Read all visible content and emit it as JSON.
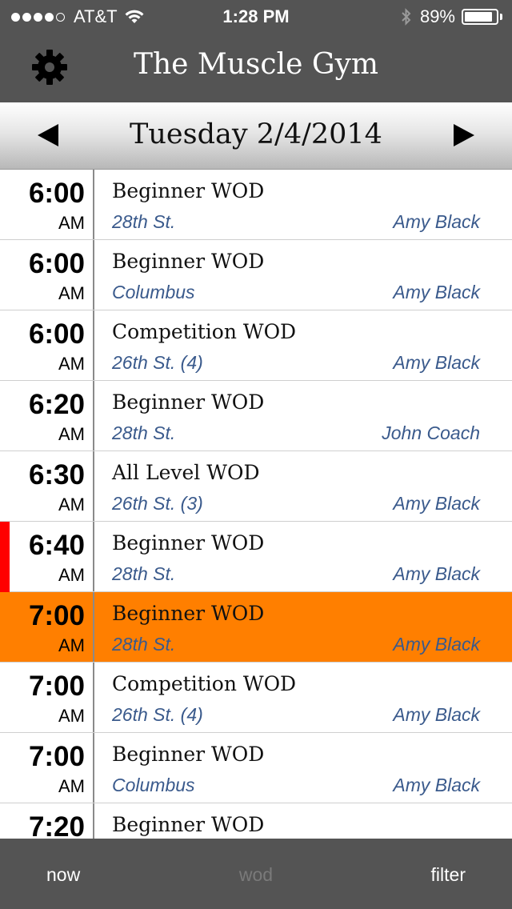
{
  "status_bar": {
    "carrier": "AT&T",
    "time": "1:28 PM",
    "battery": "89%",
    "battery_level": 0.89,
    "signal_bars": 4
  },
  "nav": {
    "title": "The Muscle Gym",
    "settings_icon": "gear-icon"
  },
  "date_bar": {
    "date": "Tuesday 2/4/2014",
    "prev_icon": "left-triangle-icon",
    "next_icon": "right-triangle-icon"
  },
  "schedule": [
    {
      "time": "6:00",
      "ampm": "AM",
      "name": "Beginner WOD",
      "location": "28th St.",
      "coach": "Amy Black"
    },
    {
      "time": "6:00",
      "ampm": "AM",
      "name": "Beginner WOD",
      "location": "Columbus",
      "coach": "Amy Black"
    },
    {
      "time": "6:00",
      "ampm": "AM",
      "name": "Competition WOD",
      "location": "26th St. (4)",
      "coach": "Amy Black"
    },
    {
      "time": "6:20",
      "ampm": "AM",
      "name": "Beginner WOD",
      "location": "28th St.",
      "coach": "John Coach"
    },
    {
      "time": "6:30",
      "ampm": "AM",
      "name": "All Level WOD",
      "location": "26th St. (3)",
      "coach": "Amy Black"
    },
    {
      "time": "6:40",
      "ampm": "AM",
      "name": "Beginner WOD",
      "location": "28th St.",
      "coach": "Amy Black"
    },
    {
      "time": "7:00",
      "ampm": "AM",
      "name": "Beginner WOD",
      "location": "28th St.",
      "coach": "Amy Black"
    },
    {
      "time": "7:00",
      "ampm": "AM",
      "name": "Competition WOD",
      "location": "26th St. (4)",
      "coach": "Amy Black"
    },
    {
      "time": "7:00",
      "ampm": "AM",
      "name": "Beginner WOD",
      "location": "Columbus",
      "coach": "Amy Black"
    },
    {
      "time": "7:20",
      "ampm": "",
      "name": "Beginner WOD",
      "location": "",
      "coach": ""
    }
  ],
  "colors": {
    "bar_background": "#545454",
    "highlight": "#ff7f00",
    "now_marker": "#ff0000",
    "link_text": "#3a5a8c",
    "tab_inactive": "#7a7a7a"
  },
  "tab_bar": {
    "now": "now",
    "wod": "wod",
    "filter": "filter"
  }
}
